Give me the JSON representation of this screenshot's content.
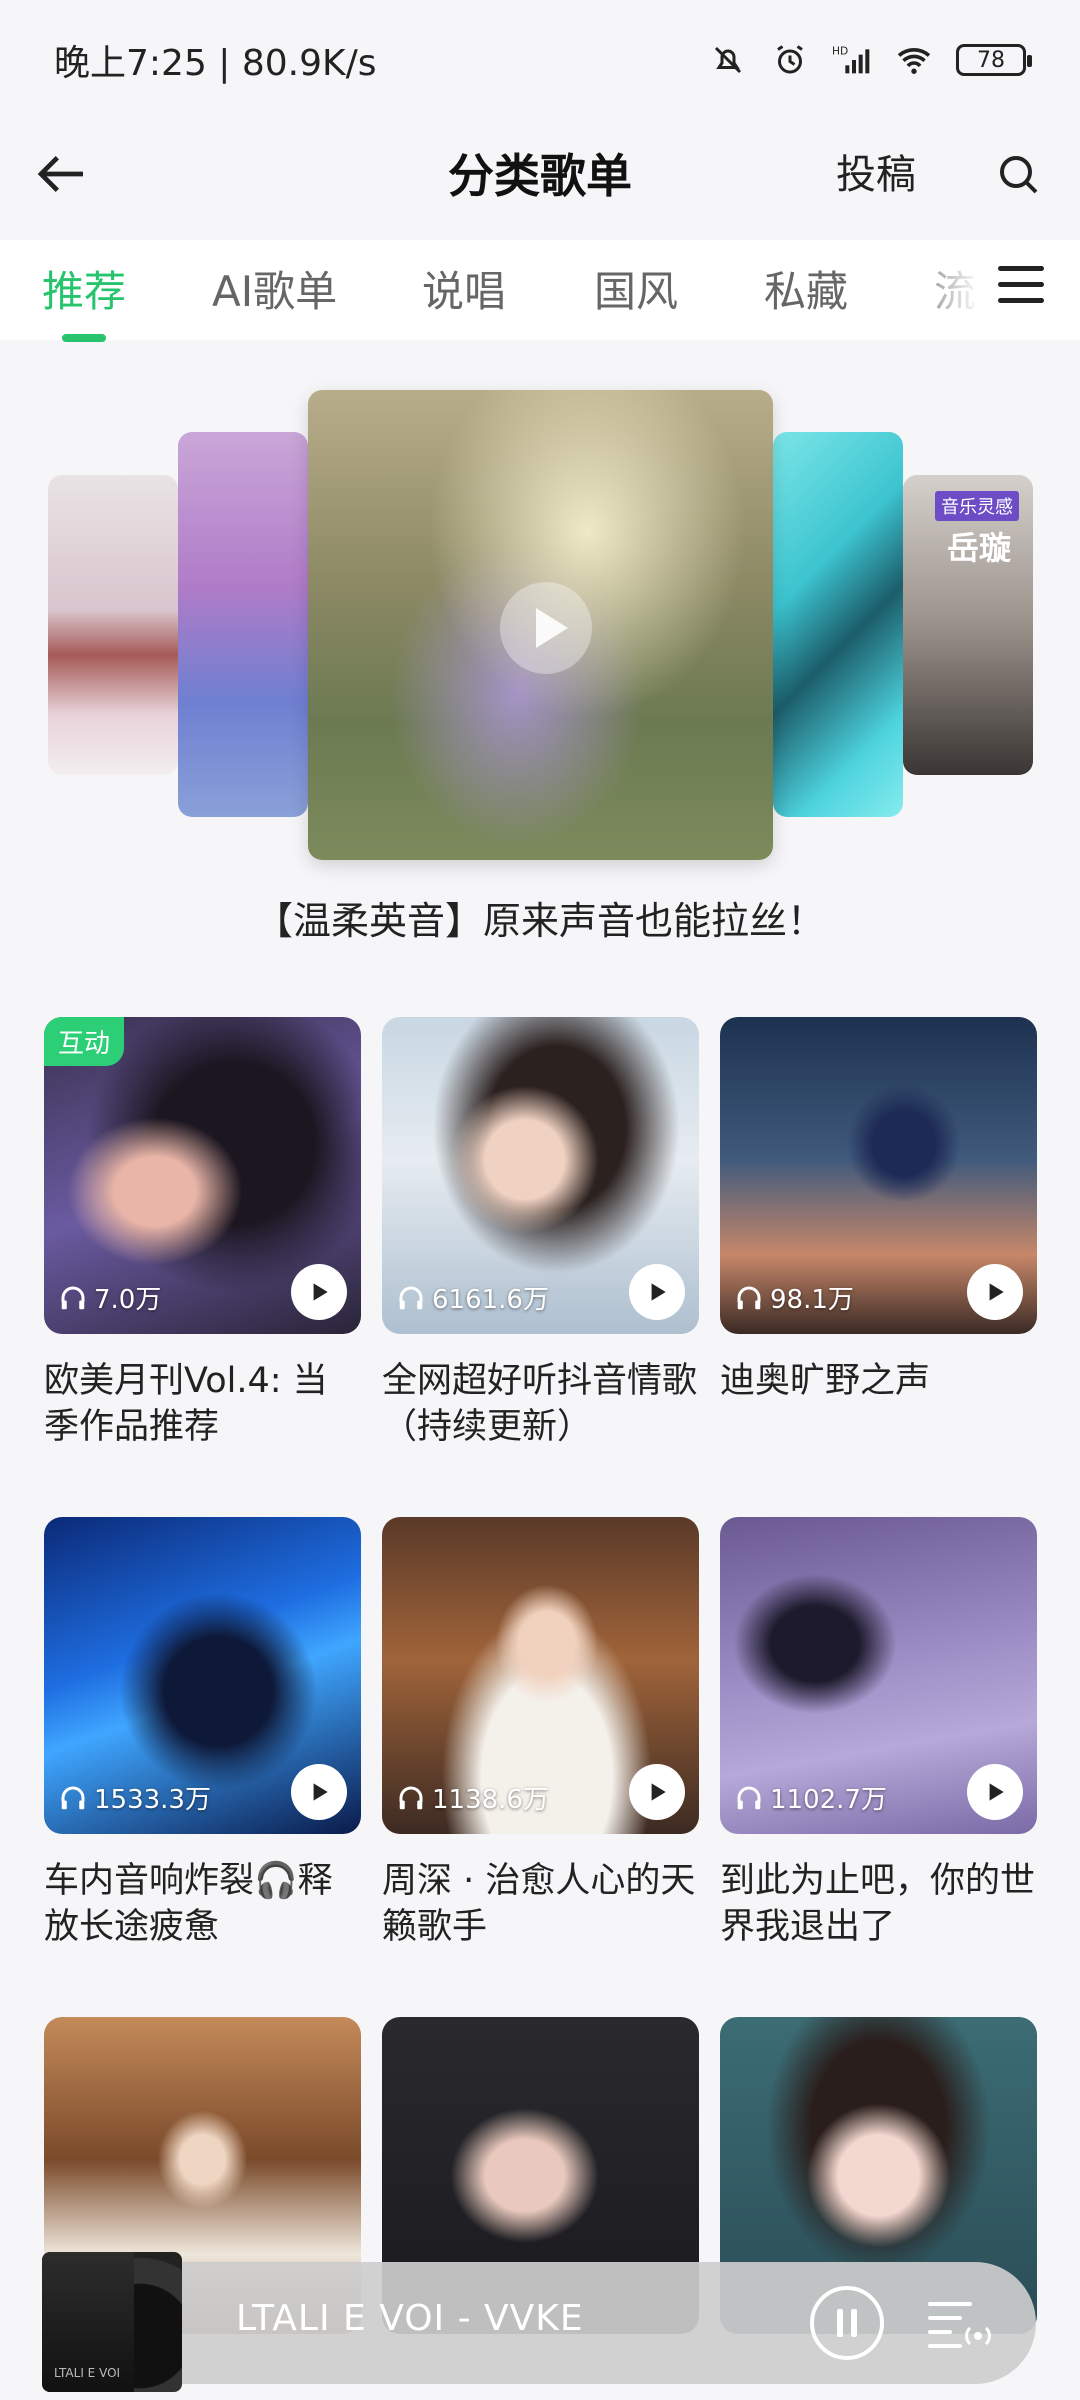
{
  "status_bar": {
    "time_speed": "晚上7:25 | 80.9K/s",
    "battery": "78",
    "icons": [
      "mute-icon",
      "alarm-icon",
      "hd-signal-icon",
      "wifi-icon",
      "battery-icon"
    ]
  },
  "header": {
    "title": "分类歌单",
    "submit": "投稿"
  },
  "tabs": [
    {
      "label": "推荐",
      "active": true
    },
    {
      "label": "AI歌单"
    },
    {
      "label": "说唱"
    },
    {
      "label": "国风"
    },
    {
      "label": "私藏"
    },
    {
      "label": "流"
    }
  ],
  "carousel": {
    "caption": "【温柔英音】原来声音也能拉丝！",
    "side_tag": "音乐灵感",
    "side_name": "岳璇"
  },
  "playlists": [
    {
      "badge": "互动",
      "plays": "7.0万",
      "title": "欧美月刊Vol.4: 当季作品推荐"
    },
    {
      "plays": "6161.6万",
      "title": "全网超好听抖音情歌（持续更新）"
    },
    {
      "plays": "98.1万",
      "title": "迪奥旷野之声"
    },
    {
      "plays": "1533.3万",
      "title": "车内音响炸裂🎧释放长途疲惫"
    },
    {
      "plays": "1138.6万",
      "title": "周深 · 治愈人心的天籁歌手"
    },
    {
      "plays": "1102.7万",
      "title": "到此为止吧，你的世界我退出了"
    },
    {
      "plays": "",
      "title": ""
    },
    {
      "plays": "",
      "title": ""
    },
    {
      "plays": "",
      "title": ""
    }
  ],
  "player": {
    "now_playing": "LTALI E VOI - VVKE",
    "art_text": "LTALI E VOI"
  }
}
